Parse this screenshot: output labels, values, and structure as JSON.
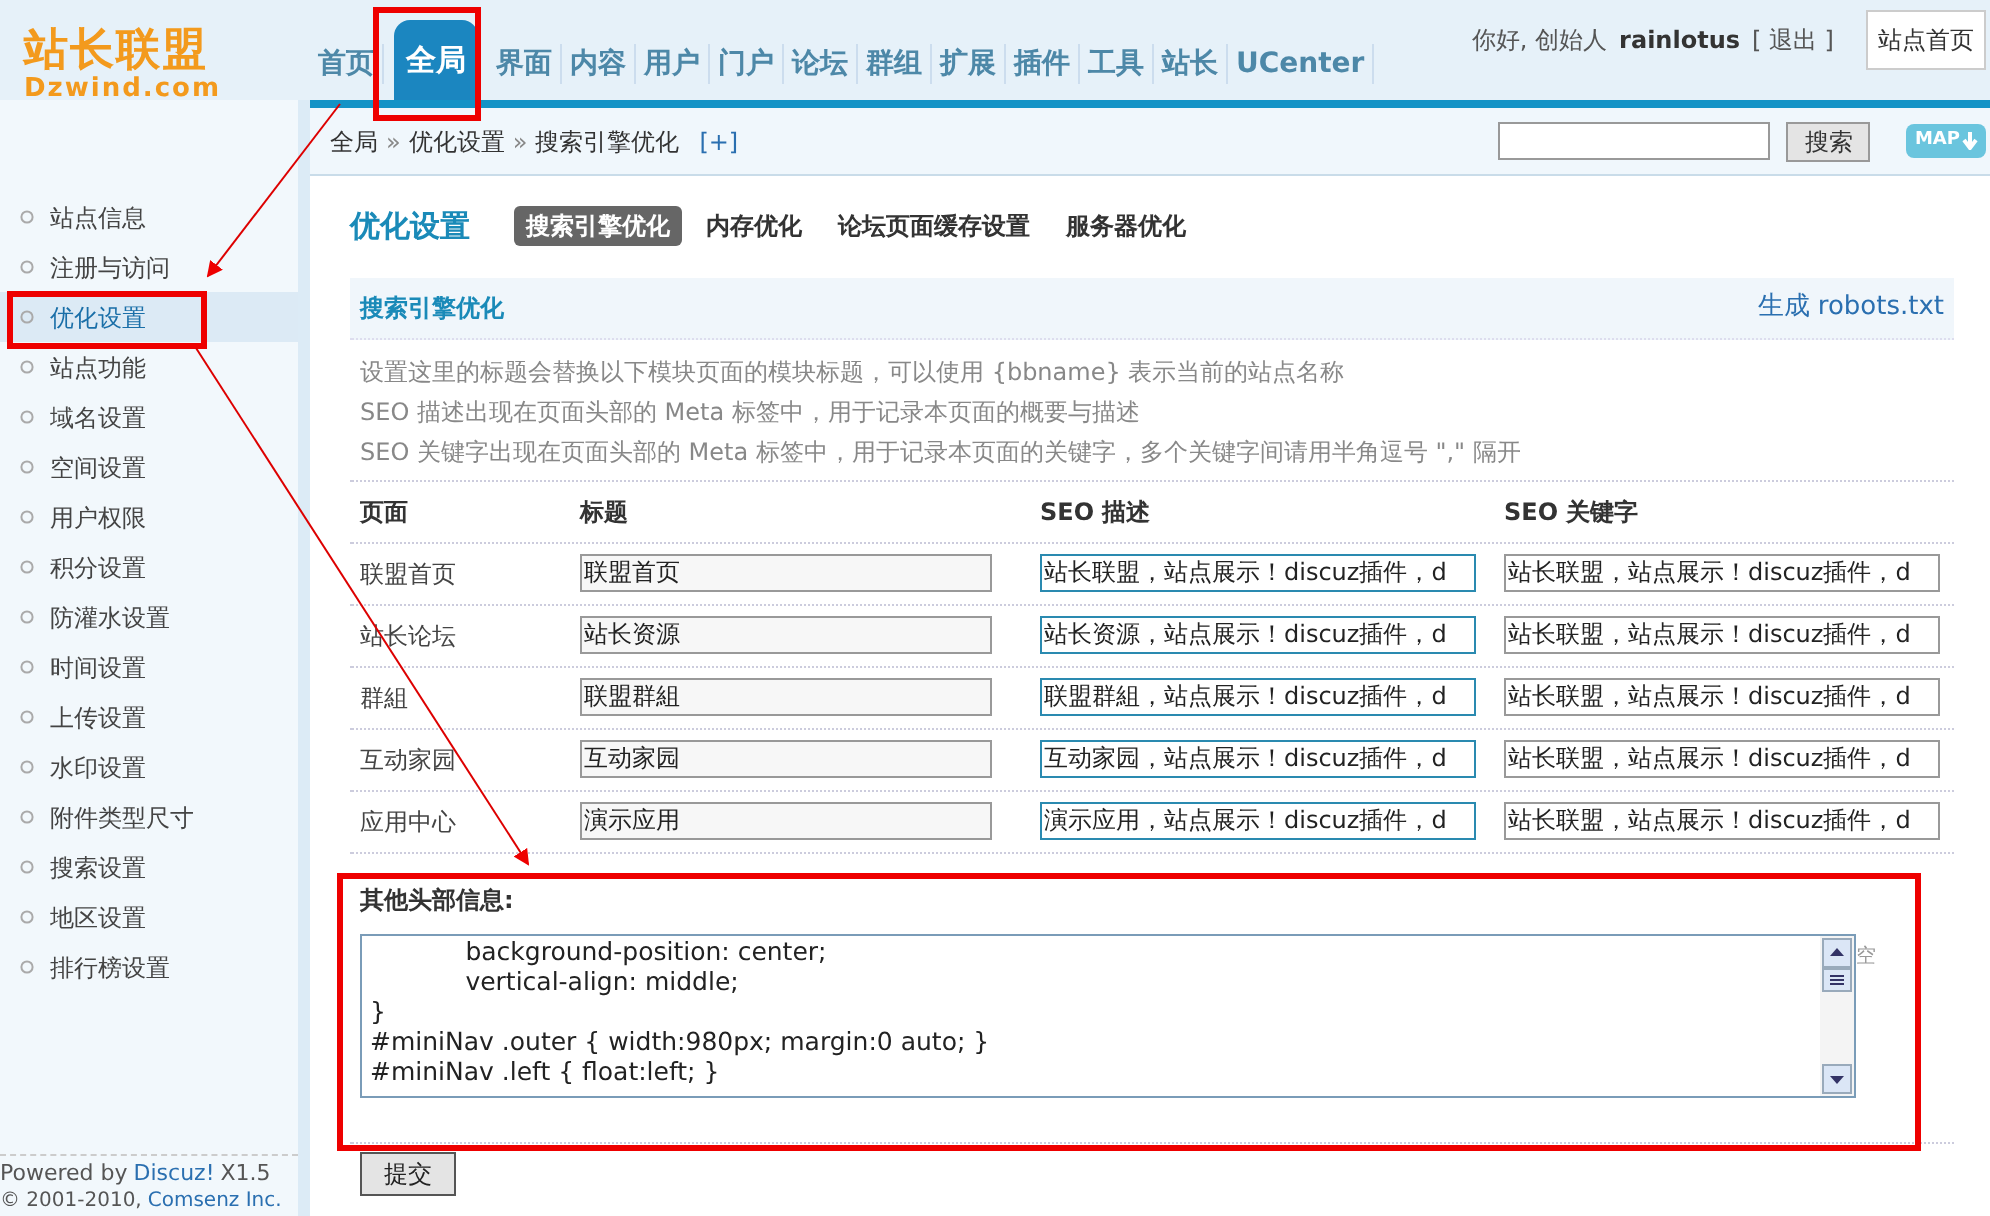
{
  "logo": {
    "title": "站长联盟",
    "subtitle": "Dzwind.com"
  },
  "nav_tabs": [
    {
      "label": "首页",
      "selected": false
    },
    {
      "label": "全局",
      "selected": true
    },
    {
      "label": "界面",
      "selected": false
    },
    {
      "label": "内容",
      "selected": false
    },
    {
      "label": "用户",
      "selected": false
    },
    {
      "label": "门户",
      "selected": false
    },
    {
      "label": "论坛",
      "selected": false
    },
    {
      "label": "群组",
      "selected": false
    },
    {
      "label": "扩展",
      "selected": false
    },
    {
      "label": "插件",
      "selected": false
    },
    {
      "label": "工具",
      "selected": false
    },
    {
      "label": "站长",
      "selected": false
    },
    {
      "label": "UCenter",
      "selected": false
    }
  ],
  "user_bar": {
    "greeting": "你好, 创始人",
    "username": "rainlotus",
    "logout": "[ 退出 ]",
    "site_home": "站点首页"
  },
  "breadcrumb": {
    "items": [
      "全局",
      "优化设置",
      "搜索引擎优化"
    ],
    "separator": "»",
    "add_shortcut": "[+]"
  },
  "search": {
    "button": "搜索",
    "map_button": "MAP"
  },
  "sidebar": {
    "items": [
      {
        "label": "站点信息",
        "selected": false
      },
      {
        "label": "注册与访问",
        "selected": false
      },
      {
        "label": "优化设置",
        "selected": true
      },
      {
        "label": "站点功能",
        "selected": false
      },
      {
        "label": "域名设置",
        "selected": false
      },
      {
        "label": "空间设置",
        "selected": false
      },
      {
        "label": "用户权限",
        "selected": false
      },
      {
        "label": "积分设置",
        "selected": false
      },
      {
        "label": "防灌水设置",
        "selected": false
      },
      {
        "label": "时间设置",
        "selected": false
      },
      {
        "label": "上传设置",
        "selected": false
      },
      {
        "label": "水印设置",
        "selected": false
      },
      {
        "label": "附件类型尺寸",
        "selected": false
      },
      {
        "label": "搜索设置",
        "selected": false
      },
      {
        "label": "地区设置",
        "selected": false
      },
      {
        "label": "排行榜设置",
        "selected": false
      }
    ],
    "footer": {
      "powered": "Powered by",
      "link": "Discuz!",
      "version": "X1.5",
      "copyright": "© 2001-2010,",
      "company": "Comsenz Inc."
    }
  },
  "page_title": "优化设置",
  "sub_tabs": [
    {
      "label": "搜索引擎优化",
      "selected": true
    },
    {
      "label": "内存优化",
      "selected": false
    },
    {
      "label": "论坛页面缓存设置",
      "selected": false
    },
    {
      "label": "服务器优化",
      "selected": false
    }
  ],
  "section": {
    "title": "搜索引擎优化",
    "action": "生成 robots.txt"
  },
  "tips": [
    "设置这里的标题会替换以下模块页面的模块标题，可以使用 {bbname} 表示当前的站点名称",
    "SEO 描述出现在页面头部的 Meta 标签中，用于记录本页面的概要与描述",
    "SEO 关键字出现在页面头部的 Meta 标签中，用于记录本页面的关键字，多个关键字间请用半角逗号 \",\" 隔开"
  ],
  "table": {
    "columns": [
      "页面",
      "标题",
      "SEO 描述",
      "SEO 关键字"
    ],
    "rows": [
      {
        "page": "联盟首页",
        "title": "联盟首页",
        "description": "站长联盟，站点展示！discuz插件，d",
        "keywords": "站长联盟，站点展示！discuz插件，d"
      },
      {
        "page": "站长论坛",
        "title": "站长资源",
        "description": "站长资源，站点展示！discuz插件，d",
        "keywords": "站长联盟，站点展示！discuz插件，d"
      },
      {
        "page": "群組",
        "title": "联盟群組",
        "description": "联盟群組，站点展示！discuz插件，d",
        "keywords": "站长联盟，站点展示！discuz插件，d"
      },
      {
        "page": "互动家园",
        "title": "互动家园",
        "description": "互动家园，站点展示！discuz插件，d",
        "keywords": "站长联盟，站点展示！discuz插件，d"
      },
      {
        "page": "应用中心",
        "title": "演示应用",
        "description": "演示应用，站点展示！discuz插件，d",
        "keywords": "站长联盟，站点展示！discuz插件，d"
      }
    ]
  },
  "other_header": {
    "label": "其他头部信息:",
    "value": "\t\tbackground-position: center;\n\t\tvertical-align: middle;\n}\n#miniNav .outer { width:980px; margin:0 auto; }\n#miniNav .left { float:left; }",
    "side_note": "空"
  },
  "submit": "提交"
}
